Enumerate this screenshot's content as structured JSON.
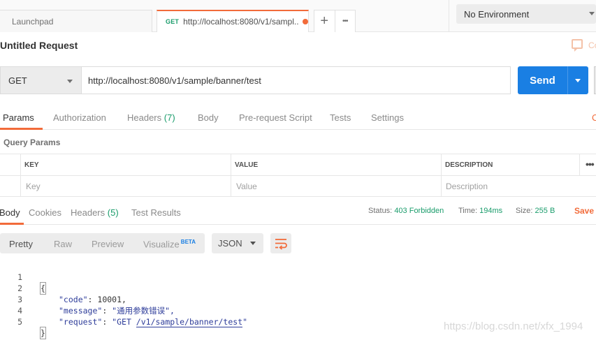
{
  "tabs": {
    "launchpad": "Launchpad",
    "active_method": "GET",
    "active_url": "http://localhost:8080/v1/sampl...",
    "new_tab_glyph": "+",
    "more_glyph": "•••"
  },
  "environment": {
    "selected": "No Environment"
  },
  "request": {
    "title": "Untitled Request",
    "comments_label": "Co",
    "method": "GET",
    "url": "http://localhost:8080/v1/sample/banner/test",
    "send_label": "Send"
  },
  "request_tabs": {
    "params": "Params",
    "authorization": "Authorization",
    "headers": "Headers",
    "headers_count": "(7)",
    "body": "Body",
    "pre_request": "Pre-request Script",
    "tests": "Tests",
    "settings": "Settings",
    "cookies_partial": "C"
  },
  "query_params": {
    "label": "Query Params",
    "headers": [
      "KEY",
      "VALUE",
      "DESCRIPTION"
    ],
    "placeholders": [
      "Key",
      "Value",
      "Description"
    ],
    "more": "•••"
  },
  "response_tabs": {
    "body": "Body",
    "cookies": "Cookies",
    "headers": "Headers",
    "headers_count": "(5)",
    "test_results": "Test Results"
  },
  "response_status": {
    "status_label": "Status:",
    "status_value": "403 Forbidden",
    "time_label": "Time:",
    "time_value": "194ms",
    "size_label": "Size:",
    "size_value": "255 B",
    "save_label": "Save"
  },
  "view_modes": {
    "pretty": "Pretty",
    "raw": "Raw",
    "preview": "Preview",
    "visualize": "Visualize",
    "beta": "BETA",
    "format": "JSON"
  },
  "code_lines": {
    "n1": "1",
    "n2": "2",
    "n3": "3",
    "n4": "4",
    "n5": "5",
    "open_brace": "{",
    "code_key": "\"code\"",
    "code_val": "10001,",
    "message_key": "\"message\"",
    "message_val": "\"通用参数错误\",",
    "request_key": "\"request\"",
    "request_val_pre": "\"GET ",
    "request_val_path": "/v1/sample/banner/test",
    "request_val_post": "\"",
    "close_brace": "}"
  },
  "watermark": "https://blog.csdn.net/xfx_1994",
  "colors": {
    "accent": "#f26b3a",
    "send_blue": "#1a7fe3",
    "success_green": "#1a9c6b"
  }
}
